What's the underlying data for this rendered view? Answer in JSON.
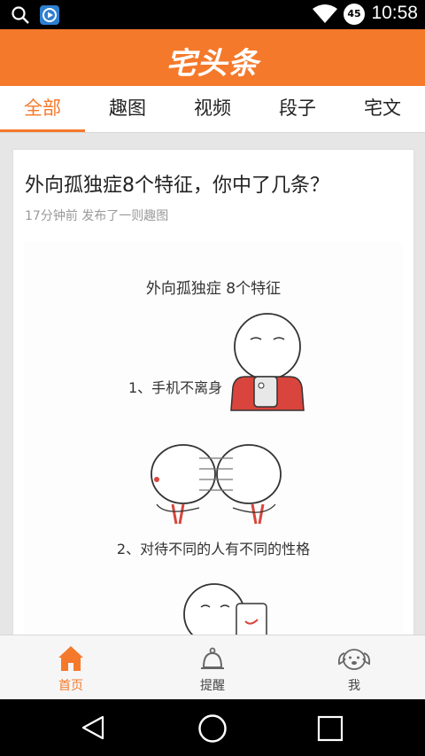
{
  "status_bar": {
    "time": "10:58",
    "battery_level": "45"
  },
  "app": {
    "logo_text": "宅头条",
    "brand_color": "#f5792b"
  },
  "tabs": [
    {
      "label": "全部",
      "active": true
    },
    {
      "label": "趣图",
      "active": false
    },
    {
      "label": "视频",
      "active": false
    },
    {
      "label": "段子",
      "active": false
    },
    {
      "label": "宅文",
      "active": false
    }
  ],
  "feed": {
    "card": {
      "title": "外向孤独症8个特征，你中了几条？",
      "meta": "17分钟前 发布了一则趣图",
      "image": {
        "heading": "外向孤独症 8个特征",
        "caption_1": "1、手机不离身",
        "caption_2": "2、对待不同的人有不同的性格"
      }
    }
  },
  "bottom_nav": [
    {
      "label": "首页",
      "icon": "home-icon",
      "active": true
    },
    {
      "label": "提醒",
      "icon": "bell-icon",
      "active": false
    },
    {
      "label": "我",
      "icon": "dog-face-icon",
      "active": false
    }
  ]
}
